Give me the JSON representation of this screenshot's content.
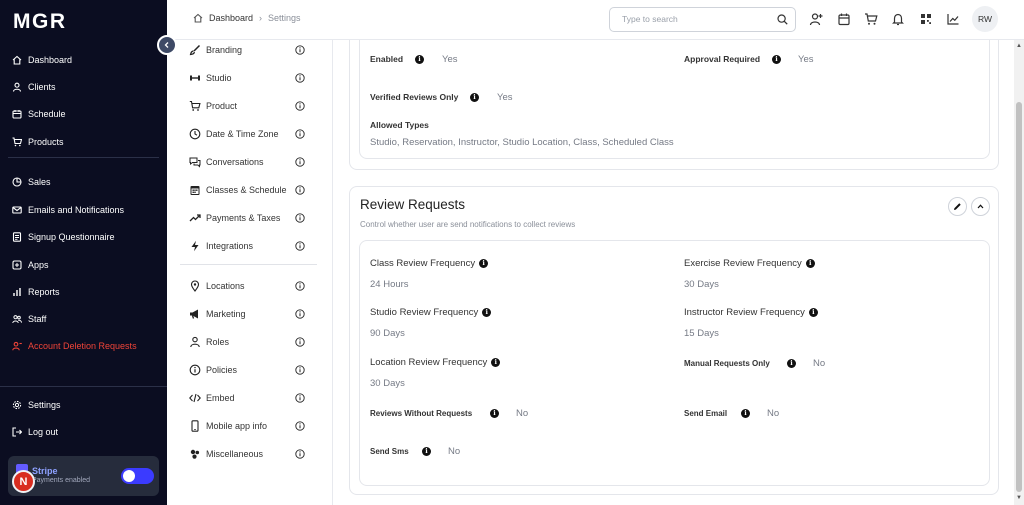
{
  "app": {
    "logo": "MGR"
  },
  "sidebar": {
    "items": [
      {
        "label": "Dashboard",
        "icon": "home-icon"
      },
      {
        "label": "Clients",
        "icon": "user-icon"
      },
      {
        "label": "Schedule",
        "icon": "calendar-icon"
      },
      {
        "label": "Products",
        "icon": "cart-icon"
      },
      {
        "label": "Sales",
        "icon": "sales-icon"
      },
      {
        "label": "Emails and Notifications",
        "icon": "mail-icon"
      },
      {
        "label": "Signup Questionnaire",
        "icon": "form-icon"
      },
      {
        "label": "Apps",
        "icon": "apps-icon"
      },
      {
        "label": "Reports",
        "icon": "bar-chart-icon"
      },
      {
        "label": "Staff",
        "icon": "staff-icon"
      },
      {
        "label": "Account Deletion Requests",
        "icon": "user-delete-icon"
      }
    ],
    "settings_label": "Settings",
    "logout_label": "Log out",
    "stripe": {
      "name": "Stripe",
      "status": "Payments enabled",
      "enabled": true
    },
    "badge": "N"
  },
  "header": {
    "breadcrumb": [
      "Dashboard",
      "Settings"
    ],
    "search_placeholder": "Type to search",
    "icons": [
      "add-user-icon",
      "calendar-icon",
      "cart-icon",
      "bell-icon",
      "qr-code-icon",
      "line-chart-icon"
    ],
    "avatar_initials": "RW"
  },
  "settings_nav": {
    "items": [
      {
        "label": "Branding",
        "icon": "brush-icon"
      },
      {
        "label": "Studio",
        "icon": "dumbbell-icon"
      },
      {
        "label": "Product",
        "icon": "cart-icon"
      },
      {
        "label": "Date & Time Zone",
        "icon": "clock-icon"
      },
      {
        "label": "Conversations",
        "icon": "chat-icon"
      },
      {
        "label": "Classes & Schedule",
        "icon": "calendar-icon"
      },
      {
        "label": "Payments & Taxes",
        "icon": "trend-icon"
      },
      {
        "label": "Integrations",
        "icon": "bolt-icon"
      },
      {
        "label": "Locations",
        "icon": "location-pin-icon"
      },
      {
        "label": "Marketing",
        "icon": "megaphone-icon"
      },
      {
        "label": "Roles",
        "icon": "person-icon"
      },
      {
        "label": "Policies",
        "icon": "policy-icon"
      },
      {
        "label": "Embed",
        "icon": "code-icon"
      },
      {
        "label": "Mobile app info",
        "icon": "mobile-icon"
      },
      {
        "label": "Miscellaneous",
        "icon": "misc-icon"
      }
    ]
  },
  "reviews_card": {
    "enabled_label": "Enabled",
    "enabled_value": "Yes",
    "approval_label": "Approval Required",
    "approval_value": "Yes",
    "verified_label": "Verified Reviews Only",
    "verified_value": "Yes",
    "allowed_types_label": "Allowed Types",
    "allowed_types_value": "Studio, Reservation, Instructor, Studio Location, Class, Scheduled Class"
  },
  "review_requests": {
    "title": "Review Requests",
    "subtitle": "Control whether user are send notifications to collect reviews",
    "class_freq_label": "Class Review Frequency",
    "class_freq_value": "24  Hours",
    "exercise_freq_label": "Exercise Review Frequency",
    "exercise_freq_value": "30  Days",
    "studio_freq_label": "Studio Review Frequency",
    "studio_freq_value": "90  Days",
    "instructor_freq_label": "Instructor Review Frequency",
    "instructor_freq_value": "15  Days",
    "location_freq_label": "Location Review Frequency",
    "location_freq_value": "30  Days",
    "manual_label": "Manual Requests Only",
    "manual_value": "No",
    "without_label": "Reviews Without Requests",
    "without_value": "No",
    "send_email_label": "Send Email",
    "send_email_value": "No",
    "send_sms_label": "Send Sms",
    "send_sms_value": "No"
  }
}
